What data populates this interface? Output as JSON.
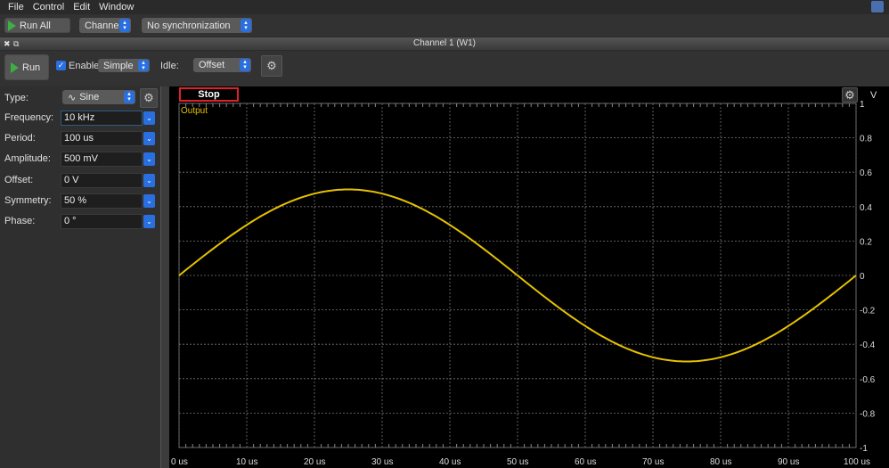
{
  "menu": [
    "File",
    "Control",
    "Edit",
    "Window"
  ],
  "toolbar": {
    "run_all": "Run All",
    "channels": "Channels",
    "sync": "No synchronization"
  },
  "dock": {
    "title": "Channel 1 (W1)"
  },
  "channel_bar": {
    "run": "Run",
    "enable": "Enable",
    "enable_checked": true,
    "mode": "Simple",
    "idle_label": "Idle:",
    "idle": "Offset"
  },
  "params": [
    {
      "label": "Type:",
      "value": "Sine"
    },
    {
      "label": "Frequency:",
      "value": "10 kHz"
    },
    {
      "label": "Period:",
      "value": "100 us"
    },
    {
      "label": "Amplitude:",
      "value": "500 mV"
    },
    {
      "label": "Offset:",
      "value": "0 V"
    },
    {
      "label": "Symmetry:",
      "value": "50 %"
    },
    {
      "label": "Phase:",
      "value": "0 °"
    }
  ],
  "plot": {
    "stop": "Stop",
    "series_label": "Output",
    "unit": "V"
  },
  "colors": {
    "trace": "#e6c200",
    "accent": "#2a6fe0",
    "stop_border": "#e0202a"
  },
  "chart_data": {
    "type": "line",
    "title": "",
    "xlabel": "",
    "ylabel": "V",
    "xlim": [
      0,
      100
    ],
    "ylim": [
      -1,
      1
    ],
    "xticks": [
      "0 us",
      "10 us",
      "20 us",
      "30 us",
      "40 us",
      "50 us",
      "60 us",
      "70 us",
      "80 us",
      "90 us",
      "100 us"
    ],
    "yticks": [
      "1",
      "0.8",
      "0.6",
      "0.4",
      "0.2",
      "0",
      "-0.2",
      "-0.4",
      "-0.6",
      "-0.8",
      "-1"
    ],
    "series": [
      {
        "name": "Output",
        "function": "0.5*sin(2*pi*t/100)",
        "amplitude": 0.5,
        "period_us": 100,
        "offset": 0
      }
    ],
    "grid": true
  }
}
